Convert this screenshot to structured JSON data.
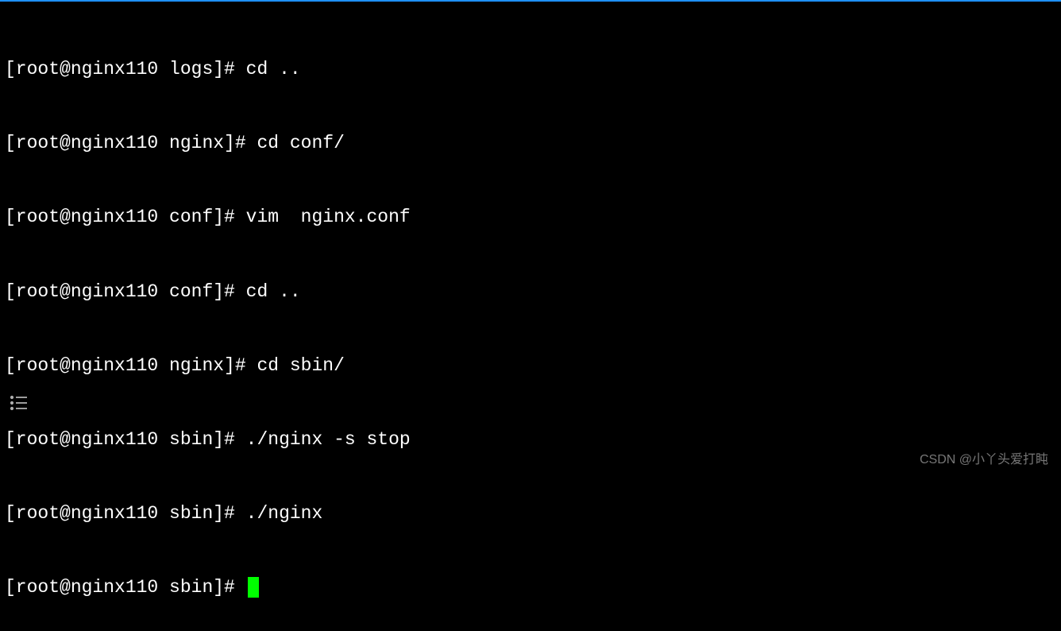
{
  "terminal": {
    "lines": [
      {
        "prompt": "[root@nginx110 logs]# ",
        "command": "cd .."
      },
      {
        "prompt": "[root@nginx110 nginx]# ",
        "command": "cd conf/"
      },
      {
        "prompt": "[root@nginx110 conf]# ",
        "command": "vim  nginx.conf"
      },
      {
        "prompt": "[root@nginx110 conf]# ",
        "command": "cd .."
      },
      {
        "prompt": "[root@nginx110 nginx]# ",
        "command": "cd sbin/"
      },
      {
        "prompt": "[root@nginx110 sbin]# ",
        "command": "./nginx -s stop"
      },
      {
        "prompt": "[root@nginx110 sbin]# ",
        "command": "./nginx"
      }
    ],
    "active_prompt": "[root@nginx110 sbin]# "
  },
  "watermark": "CSDN @小丫头爱打盹"
}
